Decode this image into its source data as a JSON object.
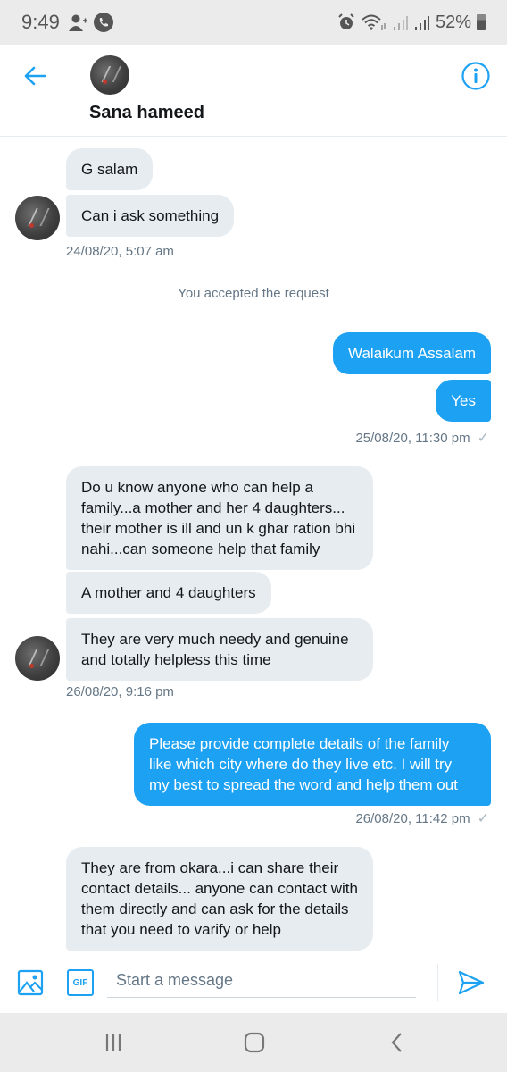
{
  "status_bar": {
    "time": "9:49",
    "left_icons": [
      "add-contact-icon",
      "phone-call-icon"
    ],
    "right_icons": [
      "alarm-icon",
      "wifi-icon",
      "signal-icon",
      "signal-icon"
    ],
    "battery": "52%"
  },
  "header": {
    "contact_name": "Sana hameed",
    "back_icon": "arrow-left-icon",
    "info_icon": "info-icon"
  },
  "colors": {
    "accent": "#1da1f2",
    "incoming_bubble": "#e6ecf0",
    "timestamp": "#657786"
  },
  "conversation": {
    "groups": [
      {
        "direction": "incoming",
        "messages": [
          "G salam",
          "Can i ask something"
        ],
        "timestamp": "24/08/20, 5:07 am"
      },
      {
        "type": "system",
        "text": "You accepted the request"
      },
      {
        "direction": "outgoing",
        "messages": [
          "Walaikum Assalam",
          "Yes"
        ],
        "timestamp": "25/08/20, 11:30 pm",
        "status": "sent"
      },
      {
        "direction": "incoming",
        "messages": [
          "Do u know anyone who can help a family...a mother and her 4 daughters... their mother is ill and un k ghar ration bhi nahi...can someone help that family",
          "A mother and 4 daughters",
          "They are very much needy and genuine and totally helpless this time"
        ],
        "timestamp": "26/08/20, 9:16 pm"
      },
      {
        "direction": "outgoing",
        "messages": [
          "Please provide complete details of the family like which city where do they live etc. I will try my best to spread the word and help them out"
        ],
        "timestamp": "26/08/20, 11:42 pm",
        "status": "sent"
      },
      {
        "direction": "incoming",
        "messages": [
          "They are from okara...i can share their contact details... anyone can contact with them directly and can ask for the details that you need to varify or help"
        ]
      }
    ]
  },
  "composer": {
    "placeholder": "Start a message",
    "value": "",
    "gif_label": "GIF"
  },
  "nav_bar": {
    "buttons": [
      "recent-apps",
      "home",
      "back"
    ]
  }
}
